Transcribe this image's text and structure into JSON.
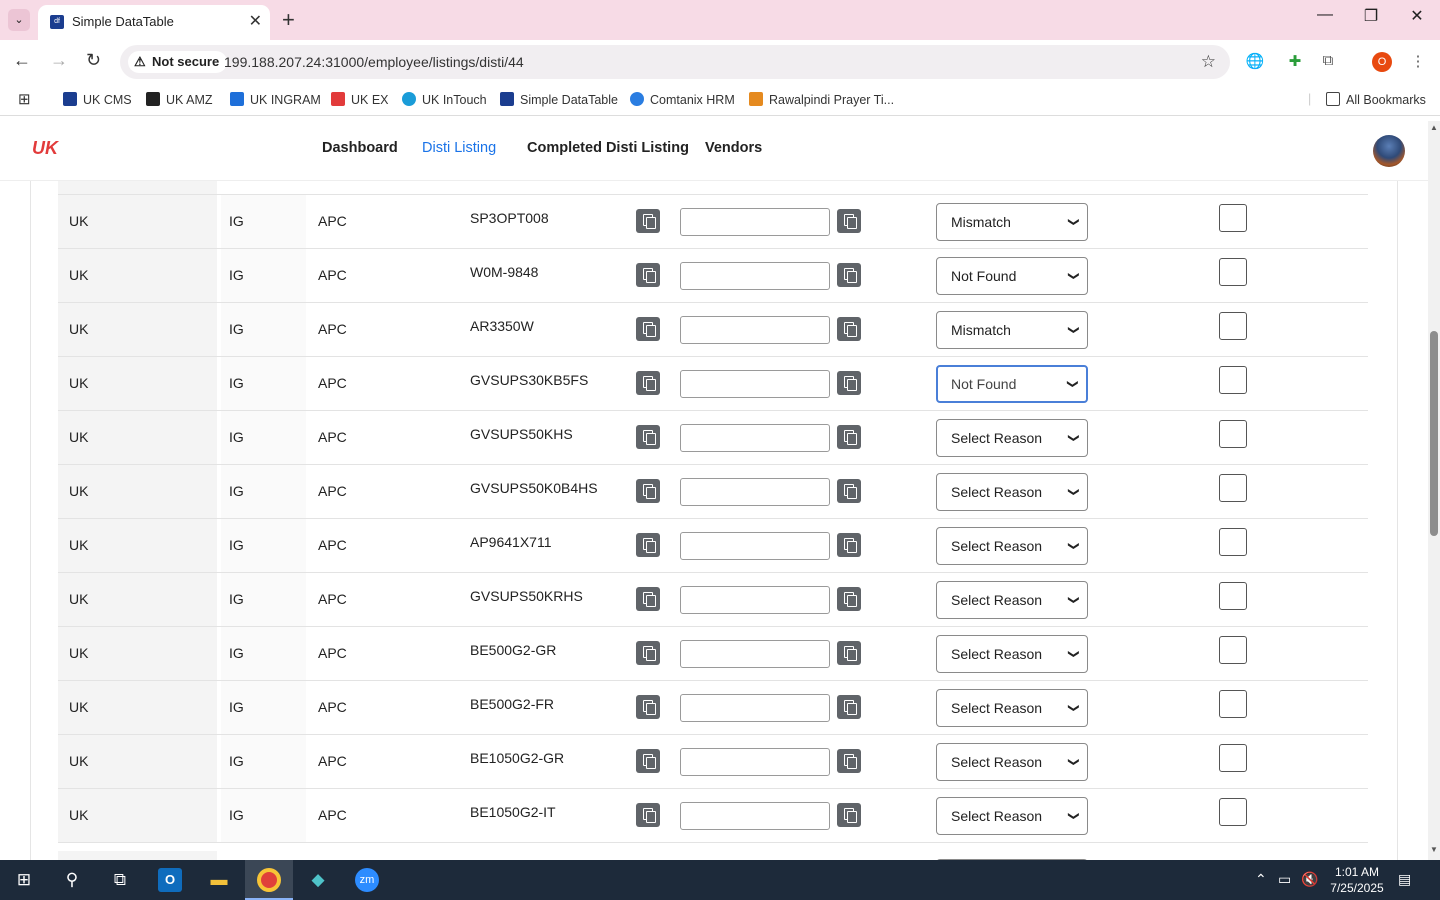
{
  "browser": {
    "tab_title": "Simple DataTable",
    "tab_favicon": "df",
    "security_label": "Not secure",
    "url": "199.188.207.24:31000/employee/listings/disti/44",
    "profile_initial": "O",
    "bookmarks": [
      {
        "label": "UK CMS",
        "color": "#1b3d8f"
      },
      {
        "label": "UK AMZ",
        "color": "#222222"
      },
      {
        "label": "UK INGRAM",
        "color": "#1e6fd9"
      },
      {
        "label": "UK EX",
        "color": "#e23b3b"
      },
      {
        "label": "UK InTouch",
        "color": "#1a9cd8"
      },
      {
        "label": "Simple DataTable",
        "color": "#1b3d8f"
      },
      {
        "label": "Comtanix HRM",
        "color": "#2a7de1"
      },
      {
        "label": "Rawalpindi Prayer Ti...",
        "color": "#e58a1f"
      }
    ],
    "all_bookmarks": "All Bookmarks"
  },
  "app": {
    "logo": "UK",
    "nav": [
      "Dashboard",
      "Disti Listing",
      "Completed Disti Listing",
      "Vendors"
    ],
    "active_nav": "Disti Listing"
  },
  "rows": [
    {
      "country": "UK",
      "dist": "IG",
      "brand": "APC",
      "part": "SP3OPT008",
      "reason": "Mismatch"
    },
    {
      "country": "UK",
      "dist": "IG",
      "brand": "APC",
      "part": "W0M-9848",
      "reason": "Not Found"
    },
    {
      "country": "UK",
      "dist": "IG",
      "brand": "APC",
      "part": "AR3350W",
      "reason": "Mismatch"
    },
    {
      "country": "UK",
      "dist": "IG",
      "brand": "APC",
      "part": "GVSUPS30KB5FS",
      "reason": "Not Found"
    },
    {
      "country": "UK",
      "dist": "IG",
      "brand": "APC",
      "part": "GVSUPS50KHS",
      "reason": "Select Reason"
    },
    {
      "country": "UK",
      "dist": "IG",
      "brand": "APC",
      "part": "GVSUPS50K0B4HS",
      "reason": "Select Reason"
    },
    {
      "country": "UK",
      "dist": "IG",
      "brand": "APC",
      "part": "AP9641X711",
      "reason": "Select Reason"
    },
    {
      "country": "UK",
      "dist": "IG",
      "brand": "APC",
      "part": "GVSUPS50KRHS",
      "reason": "Select Reason"
    },
    {
      "country": "UK",
      "dist": "IG",
      "brand": "APC",
      "part": "BE500G2-GR",
      "reason": "Select Reason"
    },
    {
      "country": "UK",
      "dist": "IG",
      "brand": "APC",
      "part": "BE500G2-FR",
      "reason": "Select Reason"
    },
    {
      "country": "UK",
      "dist": "IG",
      "brand": "APC",
      "part": "BE1050G2-GR",
      "reason": "Select Reason"
    },
    {
      "country": "UK",
      "dist": "IG",
      "brand": "APC",
      "part": "BE1050G2-IT",
      "reason": "Select Reason"
    }
  ],
  "focused_row_index": 3,
  "taskbar": {
    "time": "1:01 AM",
    "date": "7/25/2025"
  }
}
